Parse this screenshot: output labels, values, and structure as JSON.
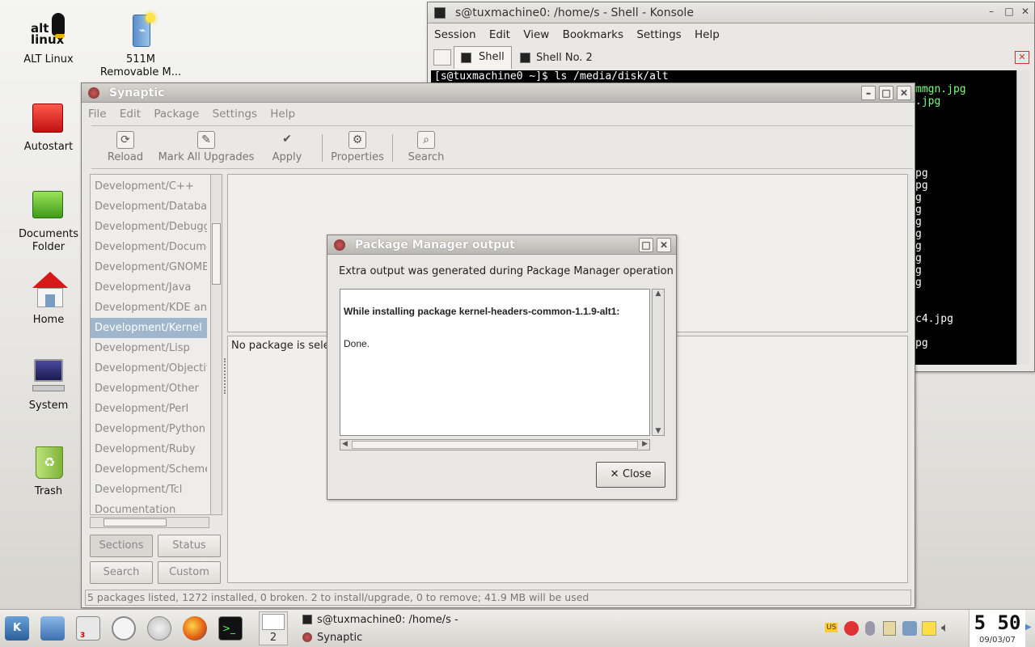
{
  "desktop": {
    "icons": [
      {
        "label": "ALT Linux"
      },
      {
        "label": "511M Removable M..."
      },
      {
        "label": "Autostart"
      },
      {
        "label": "Documents Folder"
      },
      {
        "label": "Home"
      },
      {
        "label": "System"
      },
      {
        "label": "Trash"
      }
    ],
    "altlogo": {
      "top": "alt",
      "bottom": "linux"
    }
  },
  "konsole": {
    "title": "s@tuxmachine0: /home/s - Shell - Konsole",
    "menu": [
      "Session",
      "Edit",
      "View",
      "Bookmarks",
      "Settings",
      "Help"
    ],
    "tabs": [
      "Shell",
      "Shell No. 2"
    ],
    "lines": [
      "[s@tuxmachine0 ~]$ ls /media/disk/alt",
      "mmgn.jpg",
      ".jpg",
      "pg",
      "pg",
      "g",
      "g",
      "g",
      "g",
      "g",
      "g",
      "g",
      "g",
      "c4.jpg",
      "pg"
    ]
  },
  "synaptic": {
    "title": "Synaptic",
    "menu": [
      "File",
      "Edit",
      "Package",
      "Settings",
      "Help"
    ],
    "toolbar": [
      "Reload",
      "Mark All Upgrades",
      "Apply",
      "Properties",
      "Search"
    ],
    "sections": [
      "Development/C++",
      "Development/Databa",
      "Development/Debugg",
      "Development/Docume",
      "Development/GNOME",
      "Development/Java",
      "Development/KDE an",
      "Development/Kernel",
      "Development/Lisp",
      "Development/Objectiv",
      "Development/Other",
      "Development/Perl",
      "Development/Python",
      "Development/Ruby",
      "Development/Scheme",
      "Development/Tcl",
      "Documentation"
    ],
    "selected_section": "Development/Kernel",
    "filter_buttons": [
      "Sections",
      "Status",
      "Search",
      "Custom"
    ],
    "details": "No package is sele",
    "status": "5 packages listed, 1272 installed, 0 broken. 2 to install/upgrade, 0 to remove; 41.9 MB will be used"
  },
  "dialog": {
    "title": "Package Manager output",
    "message": "Extra output was generated during Package Manager operation",
    "output_bold": "While installing package kernel-headers-common-1.1.9-alt1:",
    "output_done": "Done.",
    "close": "Close"
  },
  "taskbar": {
    "desktop_num": "2",
    "badge": "3",
    "tasks": [
      "s@tuxmachine0: /home/s -",
      "Synaptic"
    ],
    "kbd": "US",
    "clock": "5 50",
    "date": "09/03/07"
  }
}
